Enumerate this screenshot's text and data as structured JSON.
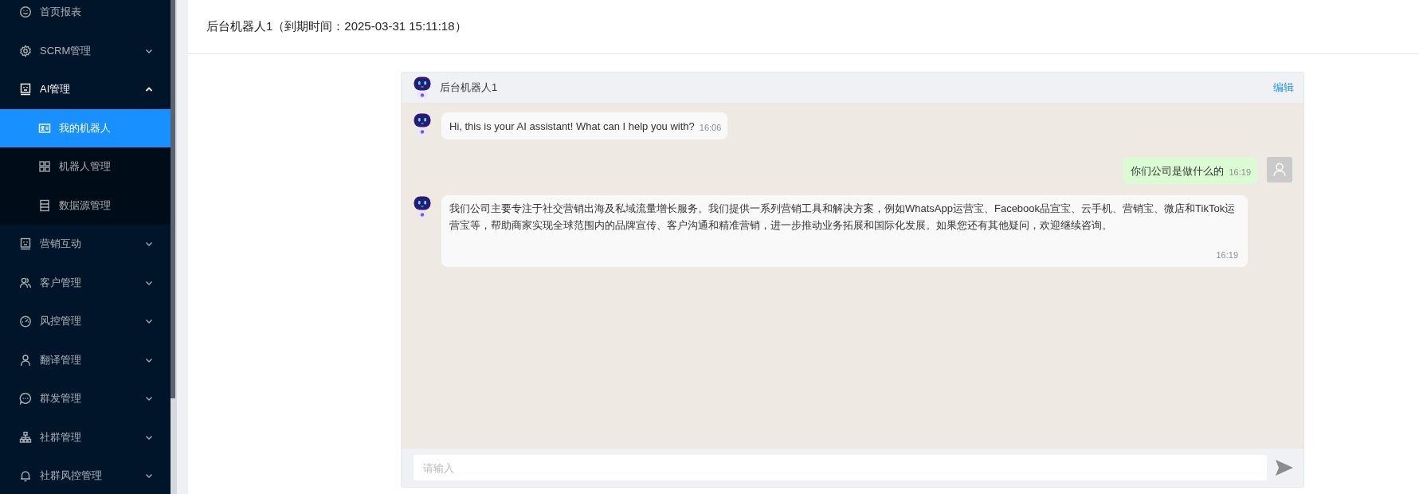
{
  "sidebar": {
    "items": [
      {
        "kind": "link",
        "label": "首页报表",
        "selected": false
      },
      {
        "kind": "group",
        "label": "SCRM管理",
        "expanded": false,
        "selected": false
      },
      {
        "kind": "group",
        "label": "AI管理",
        "expanded": true,
        "selected": false,
        "children": [
          {
            "label": "我的机器人",
            "selected": true
          },
          {
            "label": "机器人管理",
            "selected": false
          },
          {
            "label": "数据源管理",
            "selected": false
          }
        ]
      },
      {
        "kind": "group",
        "label": "营销互动",
        "expanded": false,
        "selected": false
      },
      {
        "kind": "group",
        "label": "客户管理",
        "expanded": false,
        "selected": false
      },
      {
        "kind": "group",
        "label": "风控管理",
        "expanded": false,
        "selected": false
      },
      {
        "kind": "group",
        "label": "翻译管理",
        "expanded": false,
        "selected": false
      },
      {
        "kind": "group",
        "label": "群发管理",
        "expanded": false,
        "selected": false
      },
      {
        "kind": "group",
        "label": "社群管理",
        "expanded": false,
        "selected": false
      },
      {
        "kind": "group",
        "label": "社群风控管理",
        "expanded": false,
        "selected": false
      }
    ]
  },
  "page": {
    "title": "后台机器人1（到期时间：2025-03-31 15:11:18）"
  },
  "chat": {
    "title": "后台机器人1",
    "edit_link": "编辑",
    "messages": [
      {
        "kind": "bot",
        "text": "Hi, this is your AI assistant! What can I help you with?",
        "time": "16:06"
      },
      {
        "kind": "user",
        "text": "你们公司是做什么的",
        "time": "16:19"
      },
      {
        "kind": "bot",
        "text": "我们公司主要专注于社交营销出海及私域流量增长服务。我们提供一系列营销工具和解决方案，例如WhatsApp运营宝、Facebook品宣宝、云手机、营销宝、微店和TikTok运营宝等，帮助商家实现全球范围内的品牌宣传、客户沟通和精准营销，进一步推动业务拓展和国际化发展。如果您还有其他疑问，欢迎继续咨询。",
        "time": "16:19"
      }
    ],
    "input": {
      "placeholder": "请输入"
    }
  }
}
